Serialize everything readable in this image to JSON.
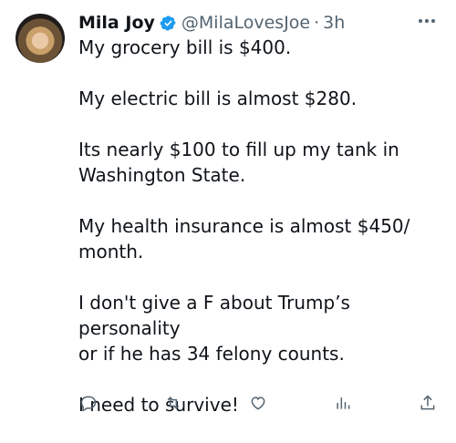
{
  "tweet": {
    "author_name": "Mila Joy",
    "handle": "@MilaLovesJoe",
    "separator": "·",
    "time": "3h",
    "paragraphs": [
      "My grocery bill is $400.",
      "My electric bill is almost $280.",
      "Its nearly $100 to fill up my tank in\nWashington State.",
      "My health insurance is almost $450/\nmonth.",
      "I don't give a F about Trump’s personality\nor if he has 34 felony counts.",
      "I need to survive!"
    ]
  },
  "icons": {
    "verified": "verified-badge-icon",
    "more": "more-options-icon"
  },
  "colors": {
    "text": "#0f1419",
    "secondary": "#536471",
    "verified": "#1d9bf0"
  }
}
